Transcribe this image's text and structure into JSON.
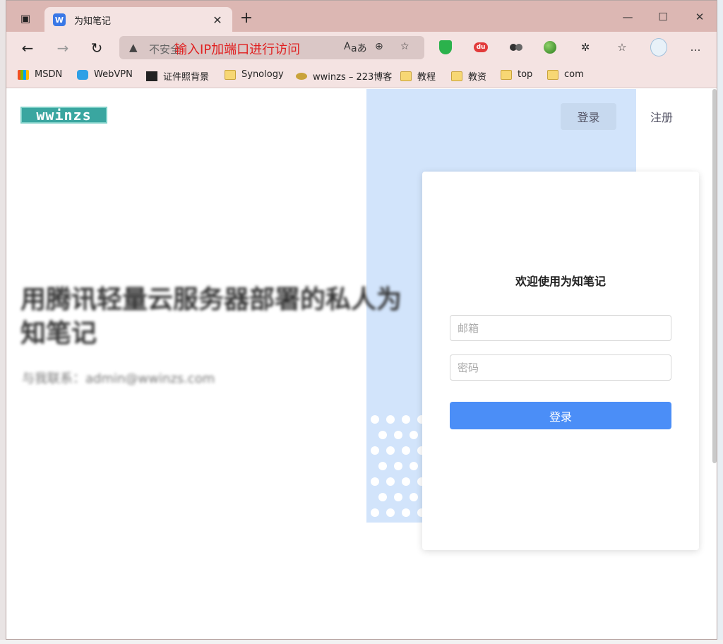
{
  "browser": {
    "tab_title": "为知笔记",
    "tab_favicon": "W",
    "address_security": "不安全",
    "address_overlay_note": "输入IP加端口进行访问"
  },
  "bookmarks": [
    {
      "label": "MSDN",
      "icon": "msdn-icon"
    },
    {
      "label": "WebVPN",
      "icon": "lock-icon"
    },
    {
      "label": "证件照背景",
      "icon": "photo-icon"
    },
    {
      "label": "Synology",
      "icon": "folder-icon"
    },
    {
      "label": "wwinzs – 223博客",
      "icon": "coin-icon"
    },
    {
      "label": "教程",
      "icon": "folder-icon"
    },
    {
      "label": "教资",
      "icon": "folder-icon"
    },
    {
      "label": "top",
      "icon": "folder-icon"
    },
    {
      "label": "com",
      "icon": "folder-icon"
    }
  ],
  "page": {
    "logo": "wwinzs",
    "nav_login": "登录",
    "nav_register": "注册",
    "hero_title": "用腾讯轻量云服务器部署的私人为知笔记",
    "hero_contact": "与我联系：admin@wwinzs.com",
    "colors": {
      "accent": "#4b8ef7",
      "panel": "#d2e4fb"
    }
  },
  "login": {
    "title": "欢迎使用为知笔记",
    "email_placeholder": "邮箱",
    "password_placeholder": "密码",
    "submit_label": "登录"
  }
}
